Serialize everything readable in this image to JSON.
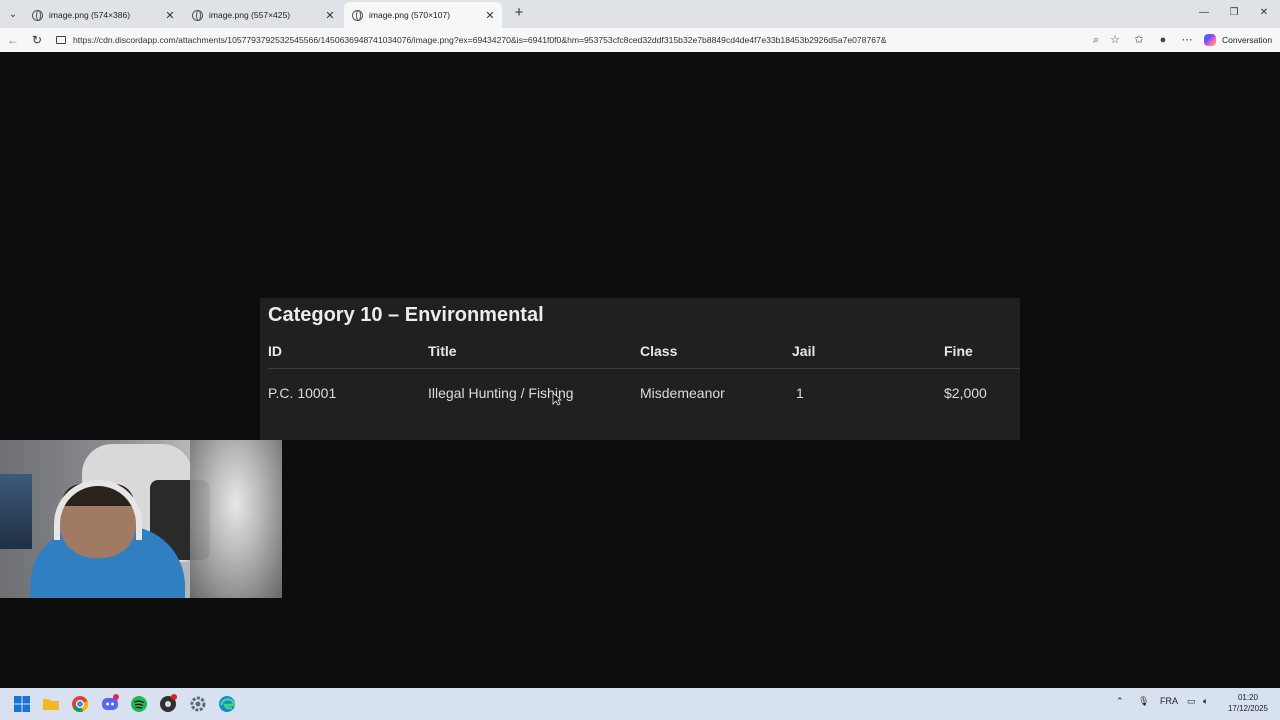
{
  "browser": {
    "tabs": [
      {
        "title": "image.png (574×386)",
        "active": false
      },
      {
        "title": "image.png (557×425)",
        "active": false
      },
      {
        "title": "image.png (570×107)",
        "active": true
      }
    ],
    "url": "https://cdn.discordapp.com/attachments/1057793792532545566/1450636948741034076/image.png?ex=69434270&is=6941f0f0&hm=953753cfc8ced32ddf315b32e7b8849cd4de4f7e33b18453b2926d5a7e078767&",
    "copilot_label": "Conversation",
    "accent_color": "#dfe3e8"
  },
  "image": {
    "heading": "Category 10 – Environmental",
    "columns": [
      "ID",
      "Title",
      "Class",
      "Jail",
      "Fine"
    ],
    "rows": [
      [
        "P.C. 10001",
        "Illegal Hunting / Fishing",
        "Misdemeanor",
        "1",
        "$2,000"
      ]
    ],
    "background": "#202020"
  },
  "taskbar": {
    "language": "FRA",
    "time": "01:20",
    "date": "17/12/2025",
    "discord_badge": "9+"
  }
}
